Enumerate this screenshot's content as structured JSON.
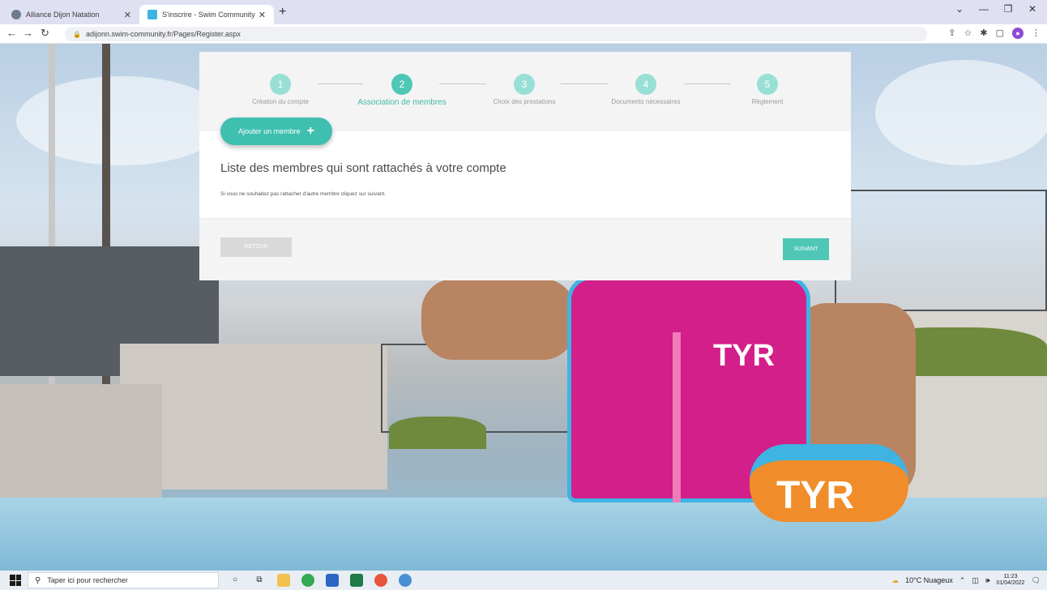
{
  "browser": {
    "tabs": [
      {
        "title": "Alliance Dijon Natation",
        "active": false
      },
      {
        "title": "S'inscrire - Swim Community",
        "active": true
      }
    ],
    "new_tab": "+",
    "url": "adijonn.swim-community.fr/Pages/Register.aspx"
  },
  "stepper": {
    "steps": [
      {
        "number": "1",
        "label": "Création du compte"
      },
      {
        "number": "2",
        "label": "Association de membres"
      },
      {
        "number": "3",
        "label": "Choix des prestations"
      },
      {
        "number": "4",
        "label": "Documents nécessaires"
      },
      {
        "number": "5",
        "label": "Règlement"
      }
    ],
    "active_step": "2"
  },
  "form": {
    "add_member_label": "Ajouter un membre",
    "add_member_icon": "plus-icon",
    "list_title": "Liste des membres qui sont rattachés à votre compte",
    "hint": "Si vous ne souhaitez pas rattacher d'autre membre cliquez sur suivant.",
    "back_label": "RETOUR",
    "next_label": "SUIVANT"
  },
  "background": {
    "logo_text": "TYR"
  },
  "taskbar": {
    "search_placeholder": "Taper ici pour rechercher",
    "weather": "10°C Nuageux",
    "time": "11:23",
    "date": "01/04/2022"
  },
  "colors": {
    "accent": "#4ec7b7",
    "accent_light": "#98dfd5",
    "button_grey": "#d9d9d9"
  }
}
